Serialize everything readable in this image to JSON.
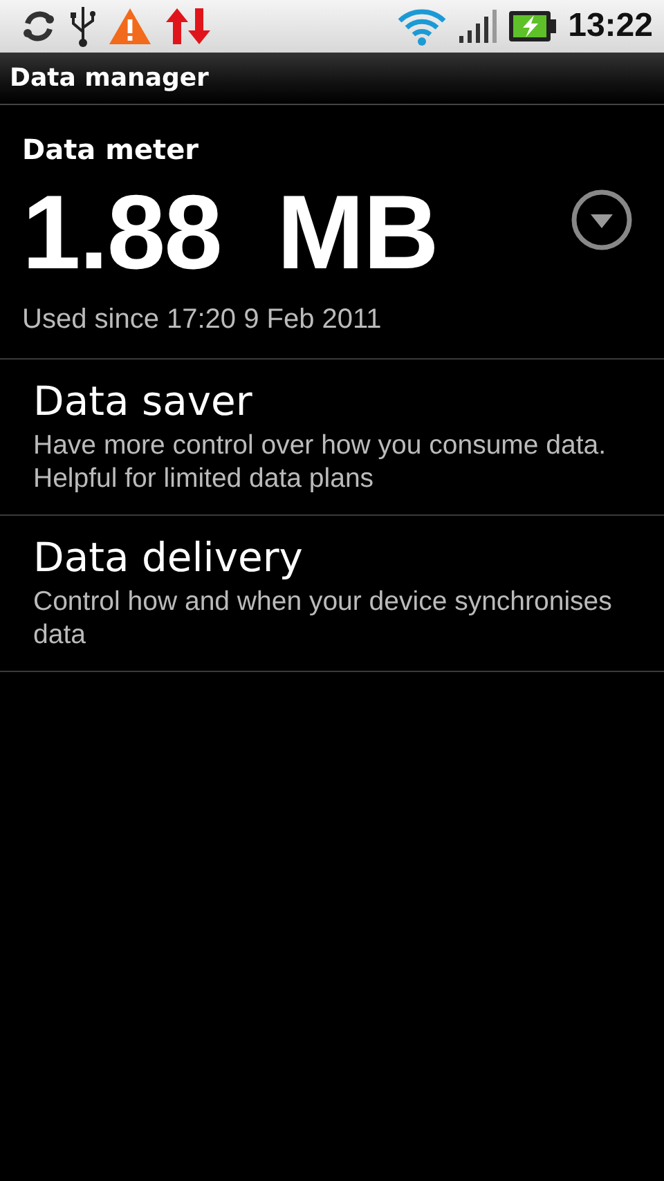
{
  "status_bar": {
    "time": "13:22"
  },
  "title_bar": {
    "title": "Data manager"
  },
  "data_meter": {
    "heading": "Data meter",
    "amount": "1.88  MB",
    "since": "Used since 17:20 9 Feb 2011"
  },
  "items": [
    {
      "title": "Data saver",
      "description": "Have more control over how you consume data. Helpful for limited data plans"
    },
    {
      "title": "Data delivery",
      "description": "Control how and when your device synchronises data"
    }
  ]
}
